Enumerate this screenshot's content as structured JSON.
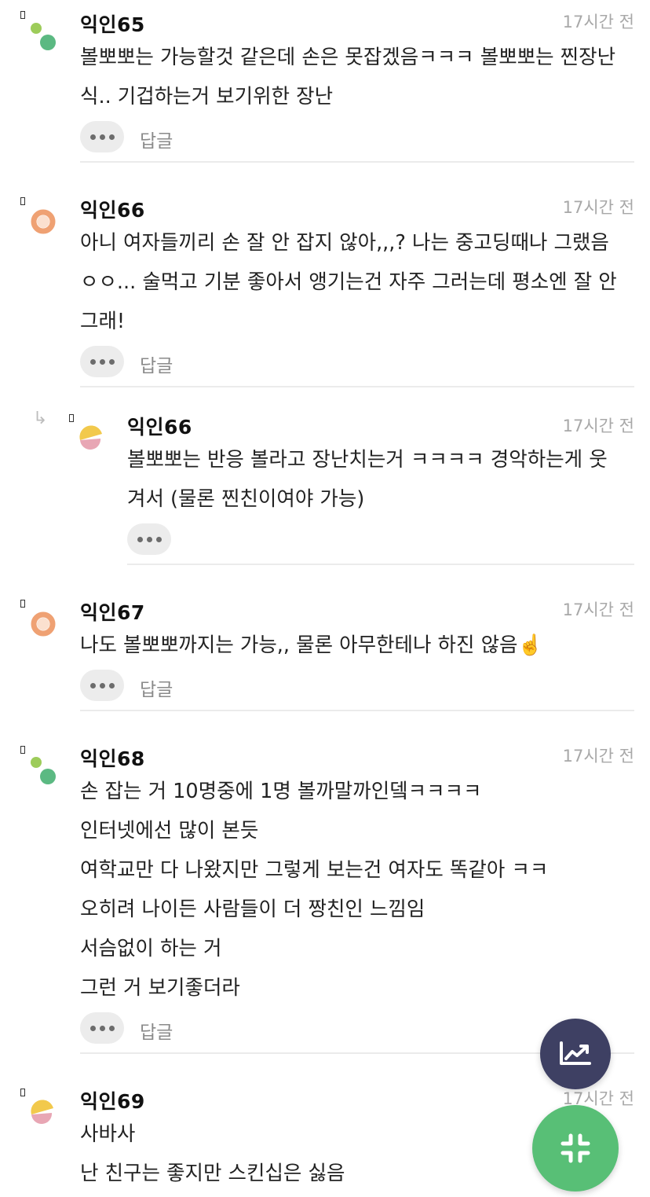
{
  "comments": [
    {
      "author": "익인65",
      "time": "17시간 전",
      "lines": [
        "볼뽀뽀는 가능할것 같은데 손은 못잡겠음ㅋㅋㅋ 볼뽀뽀는 찐장난식.. 기겁하는거 보기위한 장난"
      ],
      "reply_label": "답글",
      "avatar": "green-dots"
    },
    {
      "author": "익인66",
      "time": "17시간 전",
      "lines": [
        "아니 여자들끼리 손 잘 안 잡지 않아,,,? 나는 중고딩때나 그랬음 ㅇㅇ... 술먹고 기분 좋아서 앵기는건 자주 그러는데 평소엔 잘 안 그래!"
      ],
      "reply_label": "답글",
      "avatar": "orange-ring"
    },
    {
      "author": "익인66",
      "time": "17시간 전",
      "lines": [
        "볼뽀뽀는 반응 볼라고 장난치는거 ㅋㅋㅋㅋ 경악하는게 웃겨서 (물론 찐친이여야 가능)"
      ],
      "avatar": "yellow-pink"
    },
    {
      "author": "익인67",
      "time": "17시간 전",
      "lines": [
        "나도 볼뽀뽀까지는 가능,, 물론 아무한테나 하진 않음☝️"
      ],
      "reply_label": "답글",
      "avatar": "orange-ring"
    },
    {
      "author": "익인68",
      "time": "17시간 전",
      "lines": [
        "손 잡는 거 10명중에 1명 볼까말까인뎈ㅋㅋㅋㅋ",
        "인터넷에선 많이 본듯",
        "여학교만 다 나왔지만 그렇게 보는건 여자도 똑같아 ㅋㅋ",
        "오히려 나이든 사람들이 더 짱친인 느낌임",
        "서슴없이 하는 거",
        "그런 거 보기좋더라"
      ],
      "reply_label": "답글",
      "avatar": "green-dots"
    },
    {
      "author": "익인69",
      "time": "17시간 전",
      "lines": [
        "사바사",
        "난 친구는 좋지만 스킨십은 싫음"
      ],
      "avatar": "yellow-pink"
    }
  ],
  "fab_trend_icon": "trending-up-icon",
  "fab_collapse_icon": "collapse-icon",
  "colors": {
    "fab_dark": "#3e4063",
    "fab_green": "#58bf76",
    "green_light": "#9dcc5a",
    "green_dark": "#5bb982",
    "orange": "#efa173",
    "yellow": "#f2c94c",
    "pink": "#e8a6b4"
  }
}
